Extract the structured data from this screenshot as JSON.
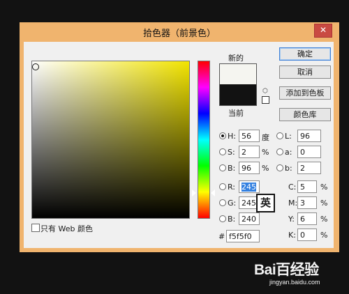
{
  "window": {
    "title": "拾色器（前景色）",
    "close_glyph": "✕"
  },
  "swatch": {
    "new_label": "新的",
    "current_label": "当前",
    "new_color": "#f5f5f0",
    "current_color": "#121212"
  },
  "buttons": {
    "ok": "确定",
    "cancel": "取消",
    "add_to_swatches": "添加到色板",
    "color_libraries": "颜色库"
  },
  "hsb": {
    "h": {
      "label": "H:",
      "value": "56",
      "unit": "度"
    },
    "s": {
      "label": "S:",
      "value": "2",
      "unit": "%"
    },
    "b": {
      "label": "B:",
      "value": "96",
      "unit": "%"
    }
  },
  "rgb": {
    "r": {
      "label": "R:",
      "value": "245"
    },
    "g": {
      "label": "G:",
      "value": "245"
    },
    "b": {
      "label": "B:",
      "value": "240"
    }
  },
  "lab": {
    "l": {
      "label": "L:",
      "value": "96"
    },
    "a": {
      "label": "a:",
      "value": "0"
    },
    "b": {
      "label": "b:",
      "value": "2"
    }
  },
  "cmyk": {
    "c": {
      "label": "C:",
      "value": "5",
      "unit": "%"
    },
    "m": {
      "label": "M:",
      "value": "3",
      "unit": "%"
    },
    "y": {
      "label": "Y:",
      "value": "6",
      "unit": "%"
    },
    "k": {
      "label": "K:",
      "value": "0",
      "unit": "%"
    }
  },
  "hex": {
    "label": "#",
    "value": "f5f5f0"
  },
  "web_only": {
    "label": "只有 Web 颜色"
  },
  "ime_indicator": "英",
  "watermark": {
    "logo": "Bai百经验",
    "url": "jingyan.baidu.com"
  },
  "colors": {
    "hue_color": "#f2e400",
    "frame": "#f0b46e",
    "close_button": "#c94a42",
    "background": "#121212"
  }
}
